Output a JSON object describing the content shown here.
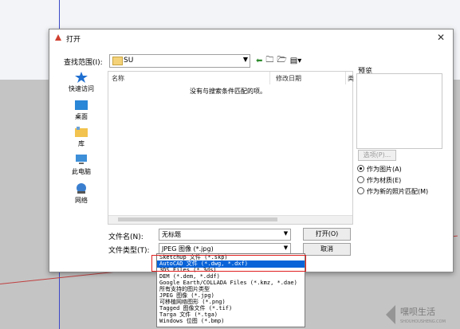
{
  "dialog": {
    "title": "打开",
    "close_glyph": "✕",
    "lookin_label": "查找范围(I):",
    "lookin_value": "SU",
    "preview_label": "预览",
    "options_button": "选项(P)...",
    "radios": [
      {
        "label": "作为图片(A)",
        "selected": true
      },
      {
        "label": "作为材质(E)",
        "selected": false
      },
      {
        "label": "作为新的照片匹配(M)",
        "selected": false
      }
    ]
  },
  "places": [
    {
      "label": "快速访问",
      "icon": "star-icon"
    },
    {
      "label": "桌面",
      "icon": "desktop-icon"
    },
    {
      "label": "库",
      "icon": "library-icon"
    },
    {
      "label": "此电脑",
      "icon": "computer-icon"
    },
    {
      "label": "网络",
      "icon": "network-icon"
    }
  ],
  "filelist": {
    "columns": [
      "名称",
      "修改日期",
      "类"
    ],
    "empty_message": "没有与搜索条件匹配的项。"
  },
  "filename": {
    "label": "文件名(N):",
    "value": "无标题"
  },
  "filetype": {
    "label": "文件类型(T):",
    "value": "JPEG 图像 (*.jpg)"
  },
  "buttons": {
    "open": "打开(O)",
    "cancel": "取消"
  },
  "filetype_options": [
    {
      "label": "SketchUp 文件 (*.skp)",
      "selected": false
    },
    {
      "label": "AutoCAD 文件 (*.dwg, *.dxf)",
      "selected": true
    },
    {
      "label": "3DS Files (*.3ds)",
      "selected": false
    },
    {
      "label": "DEM (*.dem, *.ddf)",
      "selected": false
    },
    {
      "label": "Google Earth/COLLADA Files (*.kmz, *.dae)",
      "selected": false
    },
    {
      "label": "所有支持的图片类型",
      "selected": false
    },
    {
      "label": "JPEG 图像 (*.jpg)",
      "selected": false
    },
    {
      "label": "可移植网络图形 (*.png)",
      "selected": false
    },
    {
      "label": "Tagged 图像文件 (*.tif)",
      "selected": false
    },
    {
      "label": "Targa 文件 (*.tga)",
      "selected": false
    },
    {
      "label": "Windows 位图 (*.bmp)",
      "selected": false
    }
  ],
  "watermark": {
    "text": "嘿呗生活",
    "subtext": "SHOUHOUSHENG.COM"
  },
  "colors": {
    "accent": "#0a64d8",
    "highlight_box": "#e02020",
    "toolbar_arrow": "#2e8b2e"
  }
}
